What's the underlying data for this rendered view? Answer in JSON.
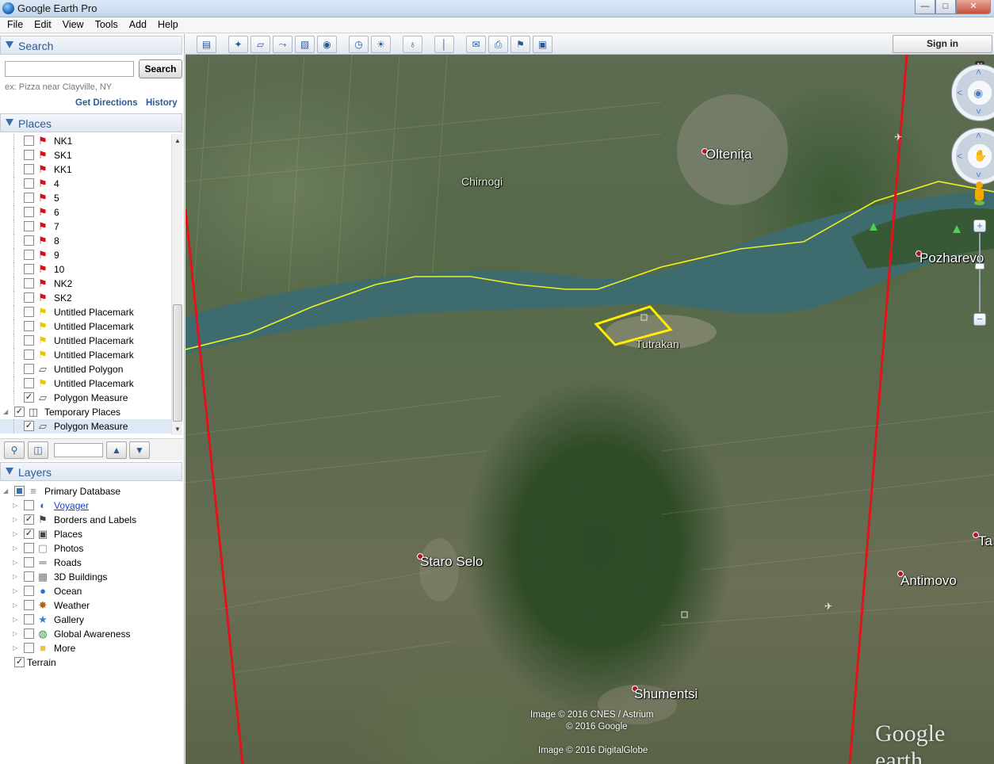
{
  "window": {
    "title": "Google Earth Pro",
    "minimize": "—",
    "maximize": "□",
    "close": "✕"
  },
  "menu": [
    "File",
    "Edit",
    "View",
    "Tools",
    "Add",
    "Help"
  ],
  "search_panel": {
    "header": "Search",
    "input_value": "",
    "button": "Search",
    "hint": "ex: Pizza near Clayville, NY",
    "get_directions": "Get Directions",
    "history": "History"
  },
  "places_panel": {
    "header": "Places",
    "items": [
      {
        "label": "NK1",
        "icon": "red-pushpin-icon",
        "checked": false
      },
      {
        "label": "SK1",
        "icon": "red-pushpin-icon",
        "checked": false
      },
      {
        "label": "KK1",
        "icon": "red-pushpin-icon",
        "checked": false
      },
      {
        "label": "4",
        "icon": "red-pushpin-icon",
        "checked": false
      },
      {
        "label": "5",
        "icon": "red-pushpin-icon",
        "checked": false
      },
      {
        "label": "6",
        "icon": "red-pushpin-icon",
        "checked": false
      },
      {
        "label": "7",
        "icon": "red-pushpin-icon",
        "checked": false
      },
      {
        "label": "8",
        "icon": "red-pushpin-icon",
        "checked": false
      },
      {
        "label": "9",
        "icon": "red-pushpin-icon",
        "checked": false
      },
      {
        "label": "10",
        "icon": "red-pushpin-icon",
        "checked": false
      },
      {
        "label": "NK2",
        "icon": "red-pushpin-icon",
        "checked": false
      },
      {
        "label": "SK2",
        "icon": "red-pushpin-icon",
        "checked": false
      },
      {
        "label": "Untitled Placemark",
        "icon": "yellow-pushpin-icon",
        "checked": false
      },
      {
        "label": "Untitled Placemark",
        "icon": "yellow-pushpin-icon",
        "checked": false
      },
      {
        "label": "Untitled Placemark",
        "icon": "yellow-pushpin-icon",
        "checked": false
      },
      {
        "label": "Untitled Placemark",
        "icon": "yellow-pushpin-icon",
        "checked": false
      },
      {
        "label": "Untitled Polygon",
        "icon": "polygon-icon",
        "checked": false
      },
      {
        "label": "Untitled Placemark",
        "icon": "yellow-pushpin-icon",
        "checked": false
      },
      {
        "label": "Polygon Measure",
        "icon": "polygon-icon",
        "checked": true
      }
    ],
    "temporary_folder": {
      "label": "Temporary Places",
      "checked": true
    },
    "temporary_items": [
      {
        "label": "Polygon Measure",
        "icon": "polygon-icon",
        "checked": true,
        "selected": true
      }
    ],
    "find_field_value": ""
  },
  "layers_panel": {
    "header": "Layers",
    "items": [
      {
        "label": "Primary Database",
        "icon": "database-icon",
        "checked": "partial",
        "level": 0
      },
      {
        "label": "Voyager",
        "icon": "voyager-icon",
        "checked": false,
        "level": 1,
        "link": true
      },
      {
        "label": "Borders and Labels",
        "icon": "flag-icon",
        "checked": true,
        "level": 1
      },
      {
        "label": "Places",
        "icon": "places-icon",
        "checked": true,
        "level": 1
      },
      {
        "label": "Photos",
        "icon": "photo-icon",
        "checked": false,
        "level": 1
      },
      {
        "label": "Roads",
        "icon": "road-icon",
        "checked": false,
        "level": 1
      },
      {
        "label": "3D Buildings",
        "icon": "building-icon",
        "checked": false,
        "level": 1
      },
      {
        "label": "Ocean",
        "icon": "ocean-icon",
        "checked": false,
        "level": 1
      },
      {
        "label": "Weather",
        "icon": "sun-icon",
        "checked": false,
        "level": 1
      },
      {
        "label": "Gallery",
        "icon": "star-icon",
        "checked": false,
        "level": 1
      },
      {
        "label": "Global Awareness",
        "icon": "globe-icon",
        "checked": false,
        "level": 1
      },
      {
        "label": "More",
        "icon": "folder-icon",
        "checked": false,
        "level": 1
      },
      {
        "label": "Terrain",
        "icon": "",
        "checked": true,
        "level": 0
      }
    ]
  },
  "toolbar": {
    "sign_in": "Sign in",
    "buttons": [
      {
        "name": "sidebar-toggle-button",
        "glyph": "▤"
      },
      {
        "name": "add-placemark-button",
        "glyph": "✦"
      },
      {
        "name": "add-polygon-button",
        "glyph": "▱"
      },
      {
        "name": "add-path-button",
        "glyph": "⤳"
      },
      {
        "name": "add-image-overlay-button",
        "glyph": "▧"
      },
      {
        "name": "record-tour-button",
        "glyph": "◉"
      },
      {
        "name": "historical-imagery-button",
        "glyph": "◷"
      },
      {
        "name": "sunlight-button",
        "glyph": "☀"
      },
      {
        "name": "planets-button",
        "glyph": "♁"
      },
      {
        "name": "ruler-button",
        "glyph": "│"
      },
      {
        "name": "email-button",
        "glyph": "✉"
      },
      {
        "name": "print-button",
        "glyph": "⎙"
      },
      {
        "name": "view-in-google-maps-button",
        "glyph": "⚑"
      },
      {
        "name": "save-image-button",
        "glyph": "▣"
      }
    ]
  },
  "map": {
    "labels": [
      {
        "text": "Oltenița",
        "dot": true
      },
      {
        "text": "Chirnogi",
        "dot": false
      },
      {
        "text": "Pozharevo",
        "dot": true
      },
      {
        "text": "Tutrakan",
        "dot": false
      },
      {
        "text": "Staro Selo",
        "dot": true
      },
      {
        "text": "Antimovo",
        "dot": true
      },
      {
        "text": "Shumentsi",
        "dot": true
      },
      {
        "text": "Ta",
        "dot": true
      }
    ],
    "credits": [
      "Image © 2016 CNES / Astrium",
      "© 2016 Google",
      "Image © 2016 DigitalGlobe"
    ],
    "logo": "Google earth",
    "compass_north": "N"
  },
  "colors": {
    "accent": "#2b5b93",
    "border_line": "#e0141a",
    "river_path": "#f0f020",
    "polygon": "#ffee00",
    "river": "#3f6d70"
  }
}
